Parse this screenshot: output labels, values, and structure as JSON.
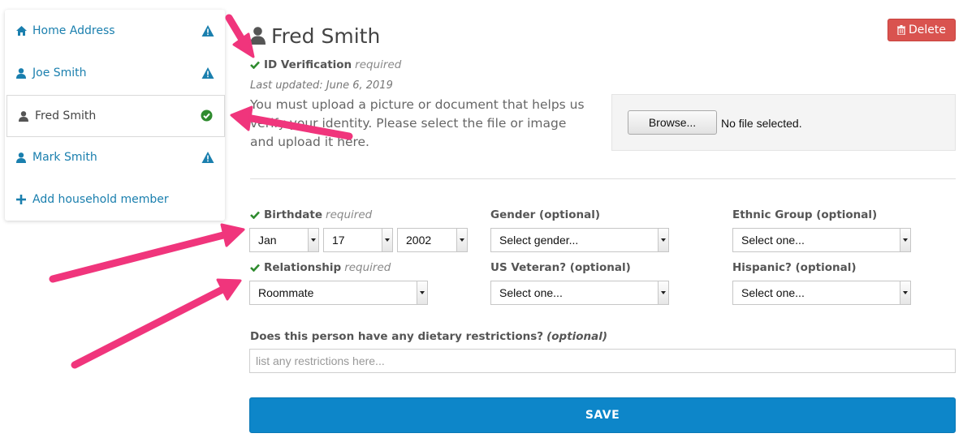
{
  "sidebar": {
    "items": [
      {
        "label": "Home Address",
        "icon": "home-icon",
        "status_icon": "warning-icon"
      },
      {
        "label": "Joe Smith",
        "icon": "user-icon",
        "status_icon": "warning-icon"
      },
      {
        "label": "Fred Smith",
        "icon": "user-icon",
        "status_icon": "check-circle-icon",
        "active": true
      },
      {
        "label": "Mark Smith",
        "icon": "user-icon",
        "status_icon": "warning-icon"
      },
      {
        "label": "Add household member",
        "icon": "plus-icon"
      }
    ]
  },
  "header": {
    "title": "Fred Smith",
    "delete_label": "Delete"
  },
  "id_verification": {
    "label": "ID Verification",
    "required": "required",
    "last_updated": "Last updated: June 6, 2019",
    "instructions": "You must upload a picture or document that helps us verify your identity. Please select the file or image and upload it here.",
    "browse_label": "Browse...",
    "file_status": "No file selected."
  },
  "form": {
    "birthdate": {
      "label": "Birthdate",
      "required": "required",
      "month": "Jan",
      "day": "17",
      "year": "2002"
    },
    "gender": {
      "label": "Gender (optional)",
      "value": "Select gender..."
    },
    "ethnic_group": {
      "label": "Ethnic Group (optional)",
      "value": "Select one..."
    },
    "relationship": {
      "label": "Relationship",
      "required": "required",
      "value": "Roommate"
    },
    "us_veteran": {
      "label": "US Veteran? (optional)",
      "value": "Select one..."
    },
    "hispanic": {
      "label": "Hispanic? (optional)",
      "value": "Select one..."
    },
    "dietary": {
      "label": "Does this person have any dietary restrictions?",
      "optional": "(optional)",
      "placeholder": "list any restrictions here..."
    },
    "save_label": "SAVE"
  },
  "colors": {
    "link": "#1a7fae",
    "warning": "#1a7fae",
    "success": "#2e8b2e",
    "delete": "#d9534f",
    "save": "#0d86c9",
    "annotation_arrow": "#f0357c"
  }
}
